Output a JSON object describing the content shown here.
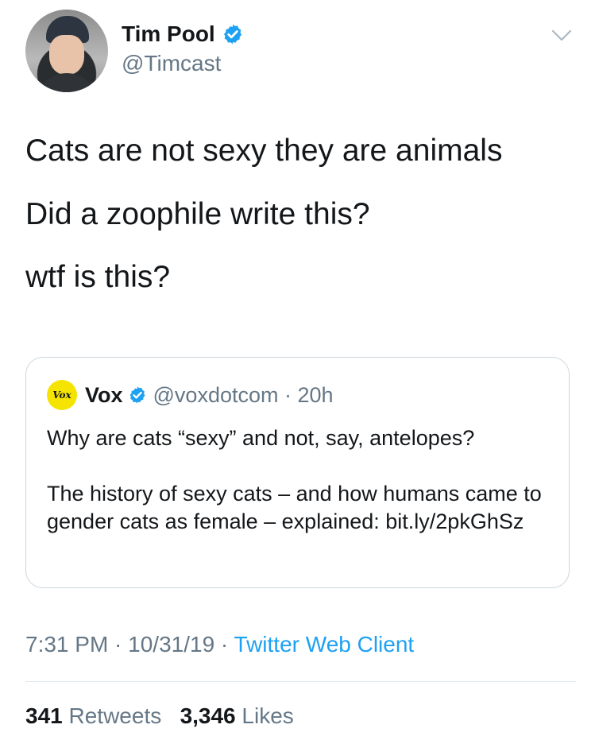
{
  "author": {
    "display_name": "Tim Pool",
    "handle": "@Timcast",
    "verified": true
  },
  "body_lines": [
    "Cats are not sexy they are animals",
    "Did a zoophile write this?",
    "wtf is this?"
  ],
  "quoted_tweet": {
    "logo_text": "Vox",
    "display_name": "Vox",
    "handle_time": "@voxdotcom · 20h",
    "verified": true,
    "paragraphs": [
      "Why are cats “sexy” and not, say, antelopes?",
      "The history of sexy cats – and how humans came to gender cats as female – explained: bit.ly/2pkGhSz"
    ]
  },
  "meta": {
    "time_date": "7:31 PM · 10/31/19 · ",
    "source": "Twitter Web Client"
  },
  "stats": {
    "retweets_count": "341",
    "retweets_label": "Retweets",
    "likes_count": "3,346",
    "likes_label": "Likes"
  },
  "colors": {
    "accent": "#1da1f2",
    "secondary_text": "#657786",
    "vox_yellow": "#f4e400"
  },
  "icons": {
    "verified": "verified-badge-icon",
    "menu": "chevron-down-icon"
  }
}
